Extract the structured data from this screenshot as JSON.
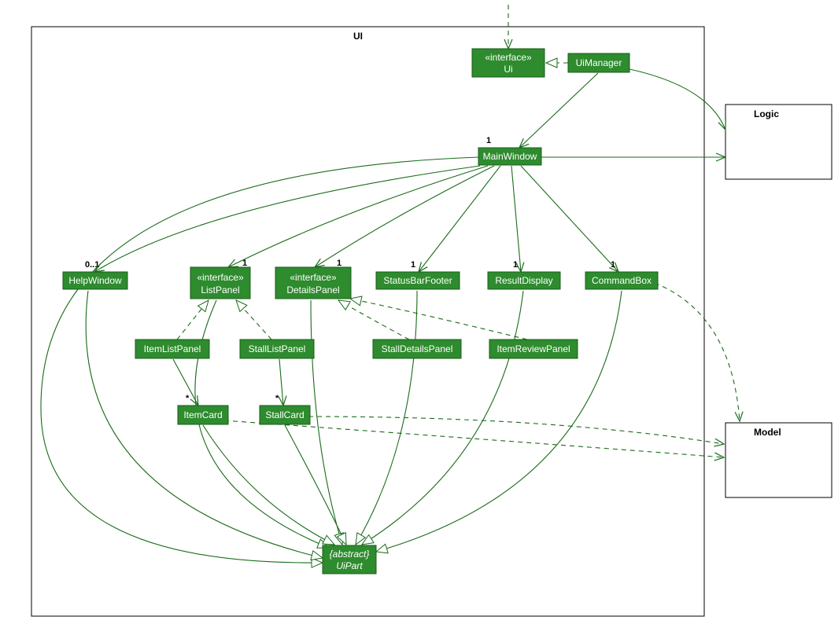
{
  "packages": {
    "ui": "UI",
    "logic": "Logic",
    "model": "Model"
  },
  "classes": {
    "ui_iface_stereo": "«interface»",
    "ui_iface_name": "Ui",
    "uimanager": "UiManager",
    "mainwindow": "MainWindow",
    "helpwindow": "HelpWindow",
    "listpanel_stereo": "«interface»",
    "listpanel_name": "ListPanel",
    "detailspanel_stereo": "«interface»",
    "detailspanel_name": "DetailsPanel",
    "statusbarfooter": "StatusBarFooter",
    "resultdisplay": "ResultDisplay",
    "commandbox": "CommandBox",
    "itemlistpanel": "ItemListPanel",
    "stalllistpanel": "StallListPanel",
    "stalldetailspanel": "StallDetailsPanel",
    "itemreviewpanel": "ItemReviewPanel",
    "itemcard": "ItemCard",
    "stallcard": "StallCard",
    "uipart_stereo": "{abstract}",
    "uipart_name": "UiPart"
  },
  "multiplicities": {
    "mainwindow": "1",
    "helpwindow": "0..1",
    "listpanel": "1",
    "detailspanel": "1",
    "statusbarfooter": "1",
    "resultdisplay": "1",
    "commandbox": "1",
    "itemcard": "*",
    "stallcard": "*"
  },
  "chart_data": {
    "type": "uml-class-diagram",
    "packages": [
      "UI",
      "Logic",
      "Model"
    ],
    "classes": [
      {
        "name": "Ui",
        "stereotype": "interface",
        "package": "UI"
      },
      {
        "name": "UiManager",
        "package": "UI"
      },
      {
        "name": "MainWindow",
        "package": "UI"
      },
      {
        "name": "HelpWindow",
        "package": "UI"
      },
      {
        "name": "ListPanel",
        "stereotype": "interface",
        "package": "UI"
      },
      {
        "name": "DetailsPanel",
        "stereotype": "interface",
        "package": "UI"
      },
      {
        "name": "StatusBarFooter",
        "package": "UI"
      },
      {
        "name": "ResultDisplay",
        "package": "UI"
      },
      {
        "name": "CommandBox",
        "package": "UI"
      },
      {
        "name": "ItemListPanel",
        "package": "UI"
      },
      {
        "name": "StallListPanel",
        "package": "UI"
      },
      {
        "name": "StallDetailsPanel",
        "package": "UI"
      },
      {
        "name": "ItemReviewPanel",
        "package": "UI"
      },
      {
        "name": "ItemCard",
        "package": "UI"
      },
      {
        "name": "StallCard",
        "package": "UI"
      },
      {
        "name": "UiPart",
        "stereotype": "abstract",
        "package": "UI"
      }
    ],
    "relationships": [
      {
        "from": "(external)",
        "to": "Ui",
        "type": "dependency"
      },
      {
        "from": "UiManager",
        "to": "Ui",
        "type": "realization"
      },
      {
        "from": "UiManager",
        "to": "MainWindow",
        "type": "association",
        "multiplicity": "1"
      },
      {
        "from": "UiManager",
        "to": "Logic",
        "type": "association"
      },
      {
        "from": "MainWindow",
        "to": "Logic",
        "type": "association"
      },
      {
        "from": "MainWindow",
        "to": "HelpWindow",
        "type": "association",
        "multiplicity": "0..1"
      },
      {
        "from": "MainWindow",
        "to": "ListPanel",
        "type": "association",
        "multiplicity": "1"
      },
      {
        "from": "MainWindow",
        "to": "DetailsPanel",
        "type": "association",
        "multiplicity": "1"
      },
      {
        "from": "MainWindow",
        "to": "StatusBarFooter",
        "type": "association",
        "multiplicity": "1"
      },
      {
        "from": "MainWindow",
        "to": "ResultDisplay",
        "type": "association",
        "multiplicity": "1"
      },
      {
        "from": "MainWindow",
        "to": "CommandBox",
        "type": "association",
        "multiplicity": "1"
      },
      {
        "from": "ItemListPanel",
        "to": "ListPanel",
        "type": "realization"
      },
      {
        "from": "StallListPanel",
        "to": "ListPanel",
        "type": "realization"
      },
      {
        "from": "StallDetailsPanel",
        "to": "DetailsPanel",
        "type": "realization"
      },
      {
        "from": "ItemReviewPanel",
        "to": "DetailsPanel",
        "type": "realization"
      },
      {
        "from": "ItemListPanel",
        "to": "ItemCard",
        "type": "association",
        "multiplicity": "*"
      },
      {
        "from": "StallListPanel",
        "to": "StallCard",
        "type": "association",
        "multiplicity": "*"
      },
      {
        "from": "MainWindow",
        "to": "UiPart",
        "type": "generalization"
      },
      {
        "from": "HelpWindow",
        "to": "UiPart",
        "type": "generalization"
      },
      {
        "from": "ListPanel",
        "to": "UiPart",
        "type": "generalization"
      },
      {
        "from": "DetailsPanel",
        "to": "UiPart",
        "type": "generalization"
      },
      {
        "from": "StatusBarFooter",
        "to": "UiPart",
        "type": "generalization"
      },
      {
        "from": "ResultDisplay",
        "to": "UiPart",
        "type": "generalization"
      },
      {
        "from": "CommandBox",
        "to": "UiPart",
        "type": "generalization"
      },
      {
        "from": "ItemCard",
        "to": "UiPart",
        "type": "generalization"
      },
      {
        "from": "StallCard",
        "to": "UiPart",
        "type": "generalization"
      },
      {
        "from": "CommandBox",
        "to": "Model",
        "type": "dependency"
      },
      {
        "from": "StallCard",
        "to": "Model",
        "type": "dependency"
      },
      {
        "from": "ItemCard",
        "to": "Model",
        "type": "dependency"
      }
    ]
  }
}
